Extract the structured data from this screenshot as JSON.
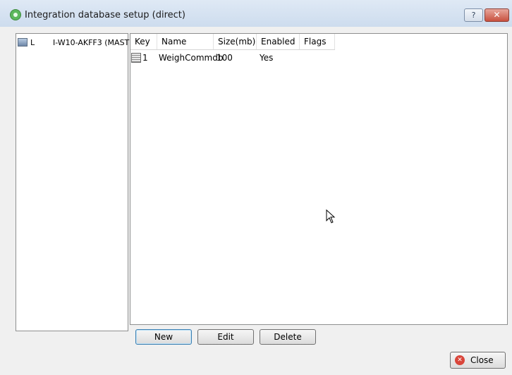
{
  "window": {
    "title": "Integration database setup (direct)",
    "help_label": "?",
    "close_label": "✕"
  },
  "server_tree": {
    "items": [
      {
        "prefix": "L",
        "name": "I-W10-AKFF3 (MAST"
      }
    ]
  },
  "databases": {
    "columns": [
      "Key",
      "Name",
      "Size(mb)",
      "Enabled",
      "Flags"
    ],
    "rows": [
      {
        "key": "1",
        "name": "WeighCommdb",
        "size_mb": "100",
        "enabled": "Yes",
        "flags": ""
      }
    ]
  },
  "actions": {
    "new_label": "New",
    "edit_label": "Edit",
    "delete_label": "Delete",
    "close_label": "Close"
  }
}
